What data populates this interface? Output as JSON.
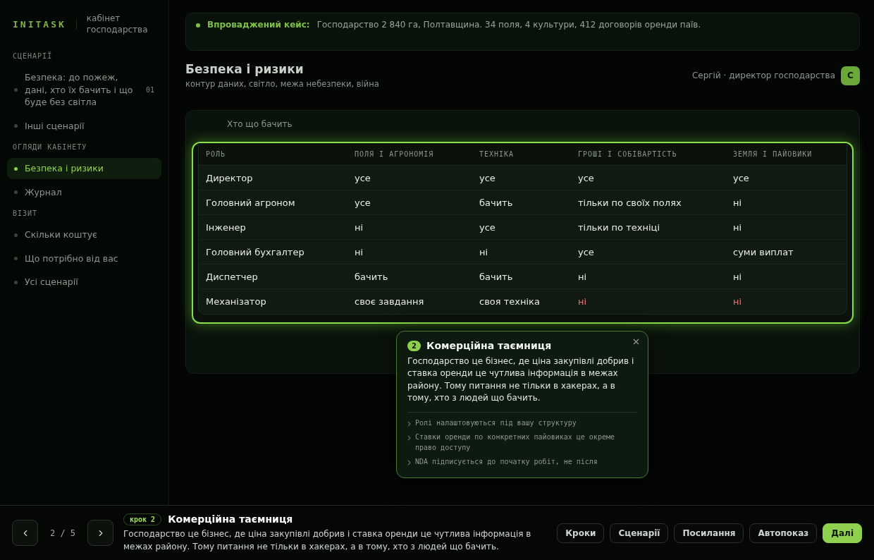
{
  "sidebar": {
    "logo": "INITASK",
    "subtitle": "кабінет господарства",
    "sections": [
      {
        "title": "СЦЕНАРІЇ",
        "items": [
          {
            "label": "Безпека: до пожеж, дані, хто їх бачить і що буде без світла",
            "count": "01",
            "selected": false
          },
          {
            "label": "Інші сценарії",
            "selected": false
          }
        ]
      },
      {
        "title": "ОГЛЯДИ КАБІНЕТУ",
        "items": [
          {
            "label": "Безпека і ризики",
            "selected": true
          },
          {
            "label": "Журнал",
            "selected": false
          }
        ]
      },
      {
        "title": "ВІЗИТ",
        "items": [
          {
            "label": "Скільки коштує",
            "selected": false
          },
          {
            "label": "Що потрібно від вас",
            "selected": false
          },
          {
            "label": "Усі сценарії",
            "selected": false
          }
        ]
      }
    ]
  },
  "banner": {
    "label": "Впроваджений кейс:",
    "text": "Господарство 2 840 га, Полтавщина. 34 поля, 4 культури, 412 договорів оренди паїв."
  },
  "header": {
    "title": "Безпека і ризики",
    "subtitle": "контур даних, світло, межа небезпеки, війна",
    "user": "Сергій · директор господарства",
    "avatar": "С"
  },
  "card": {
    "title": "Хто що бачить",
    "table": {
      "columns": [
        "РОЛЬ",
        "ПОЛЯ І АГРОНОМІЯ",
        "ТЕХНІКА",
        "ГРОШІ І СОБІВАРТІСТЬ",
        "ЗЕМЛЯ І ПАЙОВИКИ"
      ],
      "rows": [
        [
          {
            "text": "Директор",
            "alert": false
          },
          {
            "text": "усе",
            "alert": false
          },
          {
            "text": "усе",
            "alert": false
          },
          {
            "text": "усе",
            "alert": false
          },
          {
            "text": "усе",
            "alert": false
          }
        ],
        [
          {
            "text": "Головний агроном",
            "alert": false
          },
          {
            "text": "усе",
            "alert": false
          },
          {
            "text": "бачить",
            "alert": false
          },
          {
            "text": "тільки по своїх полях",
            "alert": false
          },
          {
            "text": "ні",
            "alert": false
          }
        ],
        [
          {
            "text": "Інженер",
            "alert": false
          },
          {
            "text": "ні",
            "alert": false
          },
          {
            "text": "усе",
            "alert": false
          },
          {
            "text": "тільки по техніці",
            "alert": false
          },
          {
            "text": "ні",
            "alert": false
          }
        ],
        [
          {
            "text": "Головний бухгалтер",
            "alert": false
          },
          {
            "text": "ні",
            "alert": false
          },
          {
            "text": "ні",
            "alert": false
          },
          {
            "text": "усе",
            "alert": false
          },
          {
            "text": "суми виплат",
            "alert": false
          }
        ],
        [
          {
            "text": "Диспетчер",
            "alert": false
          },
          {
            "text": "бачить",
            "alert": false
          },
          {
            "text": "бачить",
            "alert": false
          },
          {
            "text": "ні",
            "alert": false
          },
          {
            "text": "ні",
            "alert": false
          }
        ],
        [
          {
            "text": "Механізатор",
            "alert": false
          },
          {
            "text": "своє завдання",
            "alert": false
          },
          {
            "text": "своя техніка",
            "alert": false
          },
          {
            "text": "ні",
            "alert": true
          },
          {
            "text": "ні",
            "alert": true
          }
        ]
      ]
    }
  },
  "popover": {
    "number": "2",
    "title": "Комерційна таємниця",
    "text": "Господарство це бізнес, де ціна закупівлі добрив і ставка оренди це чутлива інформація в межах району. Тому питання не тільки в хакерах, а в тому, хто з людей що бачить.",
    "points": [
      "Ролі налаштовуються під вашу структуру",
      "Ставки оренди по конкретних пайовиках це окреме право доступу",
      "NDA підписується до початку робіт, не після"
    ]
  },
  "footer": {
    "counter": "2 / 5",
    "step": "крок 2",
    "title": "Комерційна таємниця",
    "text": "Господарство це бізнес, де ціна закупівлі добрив і ставка оренди це чутлива інформація в межах району. Тому питання не тільки в хакерах, а в тому, хто з людей що бачить.",
    "buttons": [
      {
        "label": "Кроки",
        "primary": false
      },
      {
        "label": "Сценарії",
        "primary": false
      },
      {
        "label": "Посилання",
        "primary": false
      },
      {
        "label": "Автопоказ",
        "primary": false
      },
      {
        "label": "Далі",
        "primary": true
      }
    ]
  }
}
